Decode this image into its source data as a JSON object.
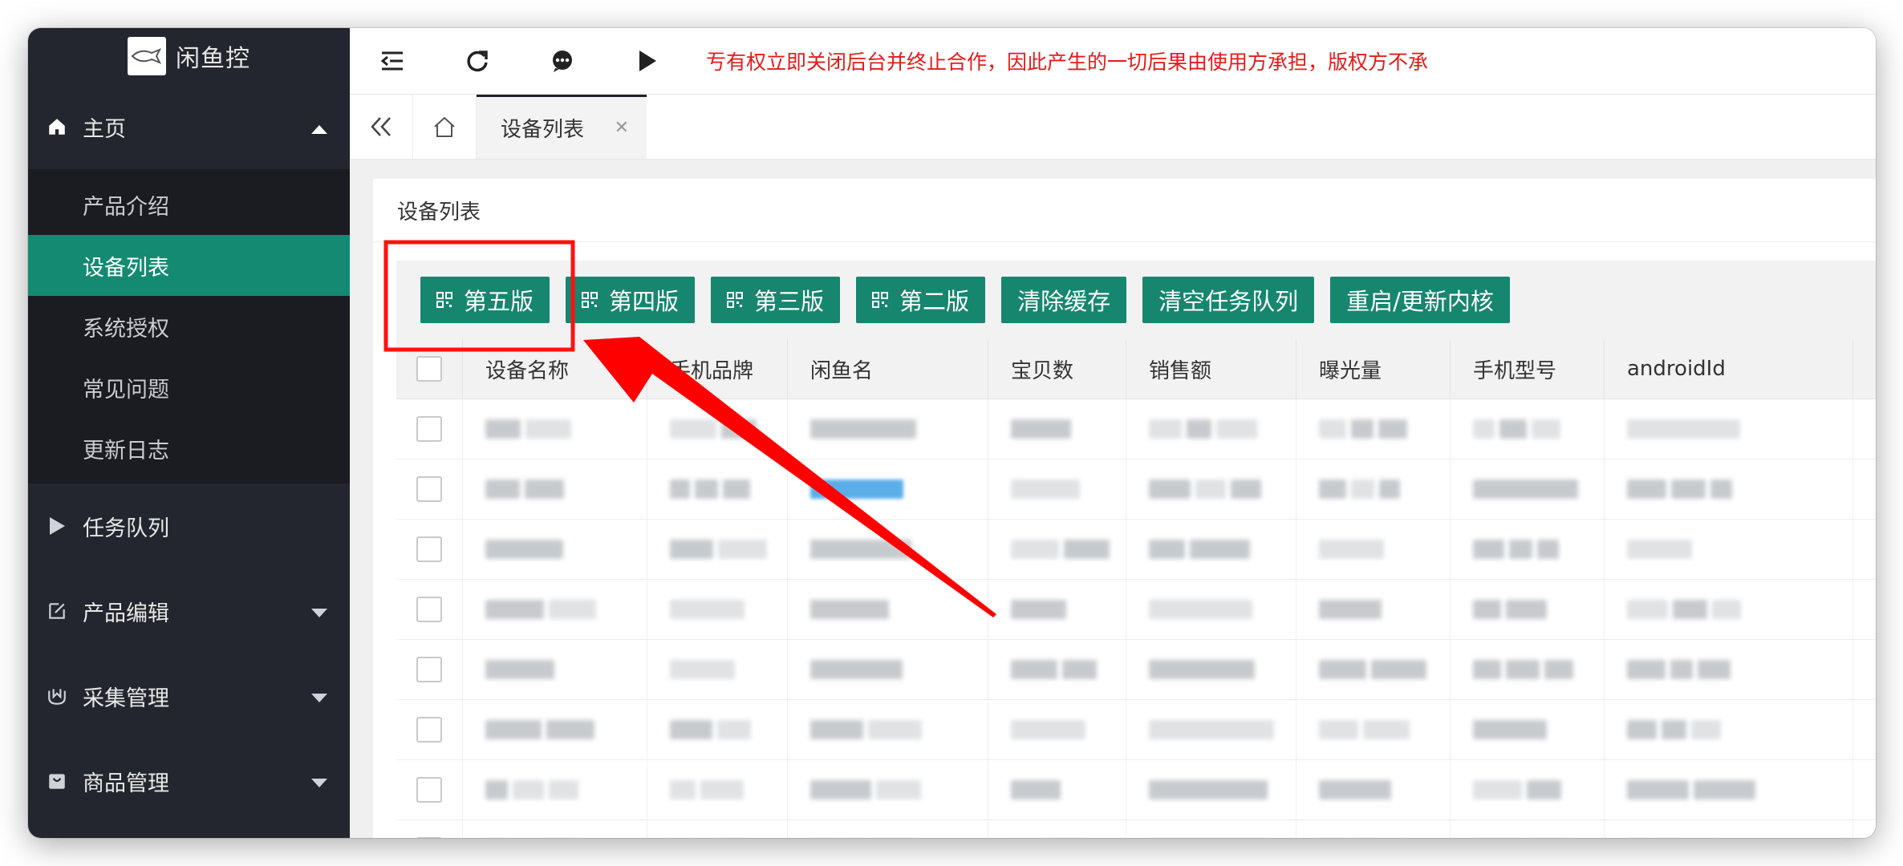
{
  "app": {
    "title": "闲鱼控"
  },
  "sidebar": {
    "home": {
      "label": "主页",
      "items": [
        "产品介绍",
        "设备列表",
        "系统授权",
        "常见问题",
        "更新日志"
      ],
      "active_index": 1
    },
    "groups": [
      {
        "label": "任务队列",
        "icon": "play-icon"
      },
      {
        "label": "产品编辑",
        "icon": "edit-icon"
      },
      {
        "label": "采集管理",
        "icon": "collect-icon"
      },
      {
        "label": "商品管理",
        "icon": "bag-icon"
      }
    ]
  },
  "topbar": {
    "notice": "亐有权立即关闭后台并终止合作，因此产生的一切后果由使用方承担，版权方不承"
  },
  "tabs": {
    "active": "设备列表"
  },
  "panel": {
    "title": "设备列表"
  },
  "toolbar": {
    "buttons": [
      "第五版",
      "第四版",
      "第三版",
      "第二版",
      "清除缓存",
      "清空任务队列",
      "重启/更新内核"
    ]
  },
  "table": {
    "columns": [
      "设备名称",
      "手机品牌",
      "闲鱼名",
      "宝贝数",
      "销售额",
      "曝光量",
      "手机型号",
      "androidId"
    ]
  },
  "colors": {
    "accent": "#148a72",
    "button": "#16866f",
    "sidebar": "#23262e",
    "notice": "#e21b1b",
    "annotation": "#ff0000"
  }
}
